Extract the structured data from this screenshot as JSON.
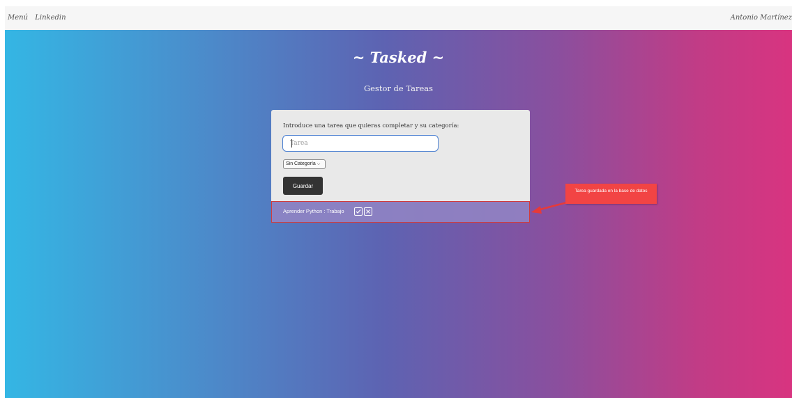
{
  "navbar": {
    "links": [
      "Menú",
      "Linkedin"
    ],
    "user_name": "Antonio Martínez"
  },
  "hero": {
    "title": "~ Tasked ~",
    "subtitle": "Gestor de Tareas",
    "gradient_colors": [
      "#34b6e4",
      "#5d63b2",
      "#d83480"
    ]
  },
  "form": {
    "prompt": "Introduce una tarea que quieras completar y su categoría:",
    "task_placeholder": "Tarea",
    "task_value": "",
    "category_selected": "Sin Categoría",
    "save_label": "Guardar"
  },
  "tasks": [
    {
      "text": "Aprender Python : Trabajo",
      "complete_icon": "check-icon",
      "delete_icon": "x-icon"
    }
  ],
  "annotation": {
    "text": "Tarea guardada en la base de datos",
    "color": "#f24444"
  }
}
